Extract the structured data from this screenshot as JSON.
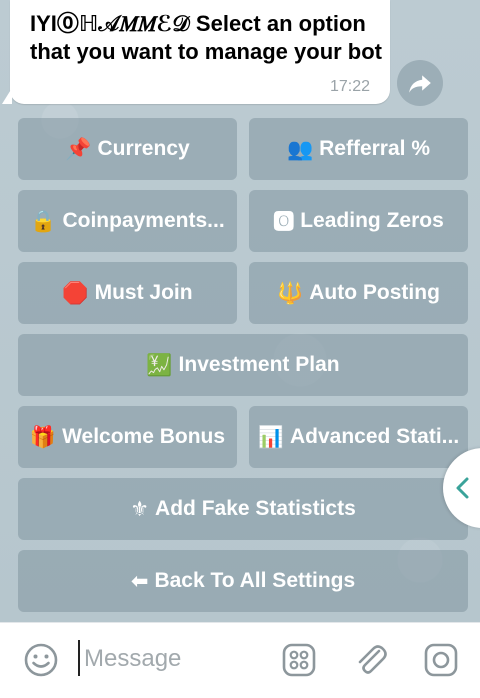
{
  "message": {
    "text": "IYI⓪ℍ𝒜𝑀𝑀ℰ𝒟 Select an option that you want to manage your bot",
    "time": "17:22"
  },
  "keyboard": {
    "currency": "Currency",
    "referral": "Refferral %",
    "coinpayments": "Coinpayments...",
    "leading_zeros": "Leading Zeros",
    "must_join": "Must Join",
    "auto_posting": "Auto Posting",
    "investment_plan": "Investment Plan",
    "welcome_bonus": "Welcome Bonus",
    "advanced_stats": "Advanced Stati...",
    "fake_stats": "Add Fake Statisticts",
    "back": "Back To All Settings"
  },
  "emoji": {
    "currency": "📌",
    "referral": "👥",
    "coinpayments": "🔒",
    "leading_zeros": "🅾",
    "must_join": "🛑",
    "auto_posting": "🔱",
    "investment_plan": "💹",
    "welcome_bonus": "🎁",
    "advanced_stats": "📊",
    "fake_stats": "⚜",
    "back": "⬅"
  },
  "input": {
    "placeholder": "Message"
  },
  "colors": {
    "button_bg": "#879ba5",
    "chat_bg": "#b9c9d0",
    "accent": "#3aa39a"
  },
  "icons": {
    "forward": "forward-icon",
    "emoji": "emoji-icon",
    "keyboard": "keyboard-icon",
    "attach": "paperclip-icon",
    "camera": "camera-icon",
    "collapse": "chevron-left-icon"
  }
}
